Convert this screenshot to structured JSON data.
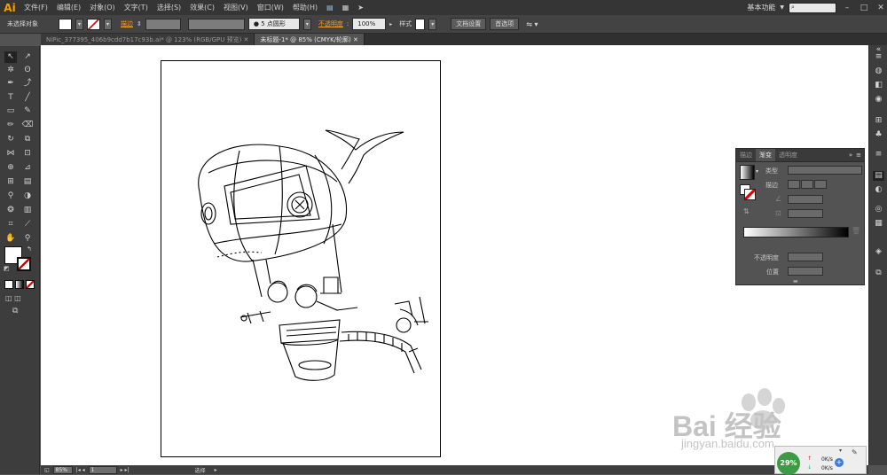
{
  "app": {
    "logo": "Ai",
    "workspace": "基本功能",
    "search_placeholder": ""
  },
  "menu": [
    "文件(F)",
    "编辑(E)",
    "对象(O)",
    "文字(T)",
    "选择(S)",
    "效果(C)",
    "视图(V)",
    "窗口(W)",
    "帮助(H)"
  ],
  "control_bar": {
    "no_selection": "未选择对象",
    "stroke_label": "描边",
    "brush_value": "5 点圆形",
    "opacity_label": "不透明度",
    "opacity_value": "100%",
    "style_label": "样式",
    "doc_setup": "文档设置",
    "preferences": "首选项"
  },
  "tabs": [
    {
      "label": "NiPic_377395_406b9cdd7b17c93b.ai* @ 123% (RGB/GPU 预览)",
      "active": false
    },
    {
      "label": "未标题-1* @ 85% (CMYK/轮廓)",
      "active": true
    }
  ],
  "gradient_panel": {
    "tabs": [
      "描边",
      "渐变",
      "透明度"
    ],
    "active_tab": "渐变",
    "type_label": "类型",
    "stroke_label": "描边",
    "opacity_label": "不透明度",
    "position_label": "位置"
  },
  "status_bar": {
    "zoom": "85%",
    "page": "1",
    "tool": "选择"
  },
  "watermark": {
    "text": "Bai 经验",
    "url": "jingyan.baidu.com"
  },
  "net_widget": {
    "percent": "29%",
    "up": "0K/s",
    "down": "0K/s"
  },
  "colors": {
    "accent_orange": "#f49c2a",
    "ui_dark": "#535353",
    "progress_green": "#3e9b45"
  }
}
